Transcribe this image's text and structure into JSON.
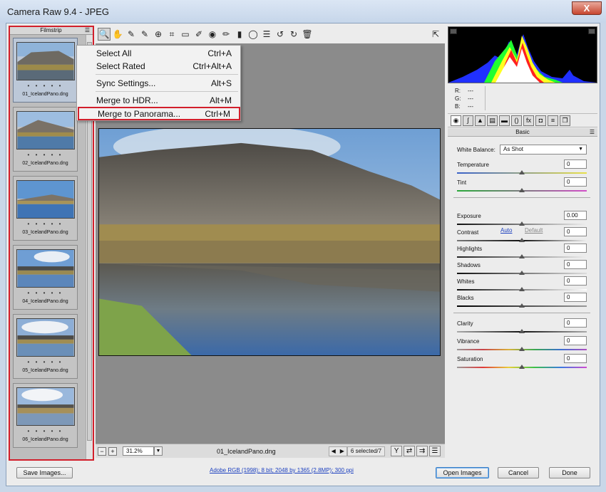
{
  "window": {
    "title": "Camera Raw 9.4  -  JPEG",
    "close_glyph": "X"
  },
  "filmstrip": {
    "title": "Filmstrip",
    "items": [
      {
        "name": "01_IcelandPano.dng",
        "rating": "• • • • •",
        "selected": true
      },
      {
        "name": "02_IcelandPano.dng",
        "rating": "• • • • •",
        "selected": false
      },
      {
        "name": "03_IcelandPano.dng",
        "rating": "• • • • •",
        "selected": false
      },
      {
        "name": "04_IcelandPano.dng",
        "rating": "• • • • •",
        "selected": false
      },
      {
        "name": "05_IcelandPano.dng",
        "rating": "• • • • •",
        "selected": false
      },
      {
        "name": "06_IcelandPano.dng",
        "rating": "• • • • •",
        "selected": false
      }
    ]
  },
  "context_menu": {
    "items": [
      {
        "label": "Select All",
        "shortcut": "Ctrl+A"
      },
      {
        "label": "Select Rated",
        "shortcut": "Ctrl+Alt+A"
      },
      {
        "label": "Sync Settings...",
        "shortcut": "Alt+S"
      },
      {
        "label": "Merge to HDR...",
        "shortcut": "Alt+M"
      },
      {
        "label": "Merge to Panorama...",
        "shortcut": "Ctrl+M"
      }
    ]
  },
  "statusbar": {
    "zoom": "31.2%",
    "filename": "01_IcelandPano.dng",
    "selection": "6 selected/7"
  },
  "histogram": {
    "r": "R:",
    "g": "G:",
    "b": "B:",
    "r_val": "---",
    "g_val": "---",
    "b_val": "---"
  },
  "basic": {
    "title": "Basic",
    "white_balance_label": "White Balance:",
    "white_balance_value": "As Shot",
    "auto": "Auto",
    "default": "Default",
    "sliders": [
      {
        "label": "Temperature",
        "value": "0"
      },
      {
        "label": "Tint",
        "value": "0"
      },
      {
        "label": "Exposure",
        "value": "0.00"
      },
      {
        "label": "Contrast",
        "value": "0"
      },
      {
        "label": "Highlights",
        "value": "0"
      },
      {
        "label": "Shadows",
        "value": "0"
      },
      {
        "label": "Whites",
        "value": "0"
      },
      {
        "label": "Blacks",
        "value": "0"
      },
      {
        "label": "Clarity",
        "value": "0"
      },
      {
        "label": "Vibrance",
        "value": "0"
      },
      {
        "label": "Saturation",
        "value": "0"
      }
    ]
  },
  "footer": {
    "save_label": "Save Images...",
    "workflow_link": "Adobe RGB (1998); 8 bit; 2048 by 1365 (2.8MP); 300 ppi",
    "open_label": "Open Images",
    "cancel_label": "Cancel",
    "done_label": "Done"
  },
  "colors": {
    "highlight_border": "#d21f2b",
    "link": "#1b3fbf"
  }
}
